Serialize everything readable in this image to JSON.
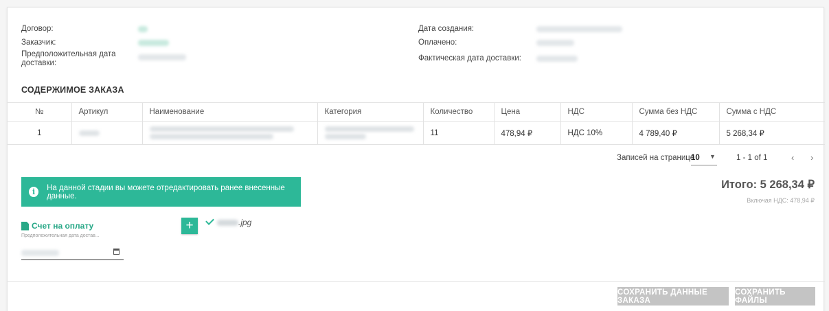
{
  "order_info": {
    "contract_label": "Договор:",
    "customer_label": "Заказчик:",
    "expected_delivery_label": "Предположительная дата доставки:",
    "created_label": "Дата создания:",
    "paid_label": "Оплачено:",
    "actual_delivery_label": "Фактическая дата доставки:"
  },
  "section_title": "СОДЕРЖИМОЕ ЗАКАЗА",
  "table": {
    "headers": [
      "№",
      "Артикул",
      "Наименование",
      "Категория",
      "Количество",
      "Цена",
      "НДС",
      "Сумма без НДС",
      "Сумма с НДС"
    ],
    "rows": [
      {
        "no": "1",
        "qty": "11",
        "price": "478,94 ₽",
        "vat": "НДС 10%",
        "sum_no_vat": "4 789,40 ₽",
        "sum_vat": "5 268,34 ₽"
      }
    ]
  },
  "pagination": {
    "per_page_label": "Записей на странице",
    "per_page_value": "10",
    "range": "1 - 1 of 1"
  },
  "alert_text": "На данной стадии вы можете отредактировать ранее внесенные данные.",
  "total": "Итого: 5 268,34 ₽",
  "total_vat": "Включая НДС: 478,94 ₽",
  "invoice": {
    "title": "Счет на оплату",
    "date_label": "Предположительная дата достав...",
    "file_ext": ".jpg"
  },
  "buttons": {
    "save_order": "СОХРАНИТЬ ДАННЫЕ ЗАКАЗА",
    "save_files": "СОХРАНИТЬ ФАЙЛЫ"
  },
  "colors": {
    "accent": "#2db898",
    "button_disabled": "#c4c4c4"
  }
}
